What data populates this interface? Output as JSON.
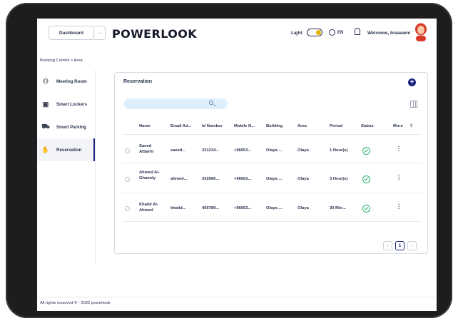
{
  "header": {
    "dashboard_label": "Dashboard",
    "more_label": "···",
    "logo_text": "POWERLOOK",
    "theme_label": "Light",
    "language": "EN",
    "welcome": "Welcome, braaawni"
  },
  "breadcrumb": "Booking Control > Area",
  "sidebar": {
    "items": [
      {
        "label": "Meeting Room",
        "icon": "meeting-room-icon",
        "glyph": "⚇"
      },
      {
        "label": "Smart Lockers",
        "icon": "locker-icon",
        "glyph": "▣"
      },
      {
        "label": "Smart Parking",
        "icon": "parking-icon",
        "glyph": "⛟"
      },
      {
        "label": "Reservation",
        "icon": "reservation-icon",
        "glyph": "✋"
      }
    ]
  },
  "card": {
    "title": "Reservation",
    "add_label": "+",
    "search_placeholder": ""
  },
  "table": {
    "headers": [
      "Name",
      "Email Ad...",
      "Id Number",
      "Mobile N...",
      "Building",
      "Area",
      "Period",
      "Status",
      "More"
    ],
    "sort_glyph": "⇕",
    "rows": [
      {
        "name": "Saeed AlSarhi",
        "email": "saeed...",
        "id": "331234...",
        "mobile": "+96653...",
        "building": "Olaya ...",
        "area": "Olaya",
        "period": "1 Hour(s)"
      },
      {
        "name": "Ahmed Al-Ghamdy",
        "email": "ahmed...",
        "id": "332566...",
        "mobile": "+96653...",
        "building": "Olaya ...",
        "area": "Olaya",
        "period": "3 Hour(s)"
      },
      {
        "name": "Khalid Al-Ahmed",
        "email": "khalid...",
        "id": "456789...",
        "mobile": "+96653...",
        "building": "Olaya ...",
        "area": "Olaya",
        "period": "30 Min..."
      }
    ]
  },
  "pagination": {
    "prev": "‹",
    "current": "1",
    "next": "›"
  },
  "footer": "All rights reserved © - 2022 powerlook",
  "colors": {
    "accent": "#1a237e",
    "success": "#2ab36d",
    "search_bg": "#dfeefb"
  }
}
